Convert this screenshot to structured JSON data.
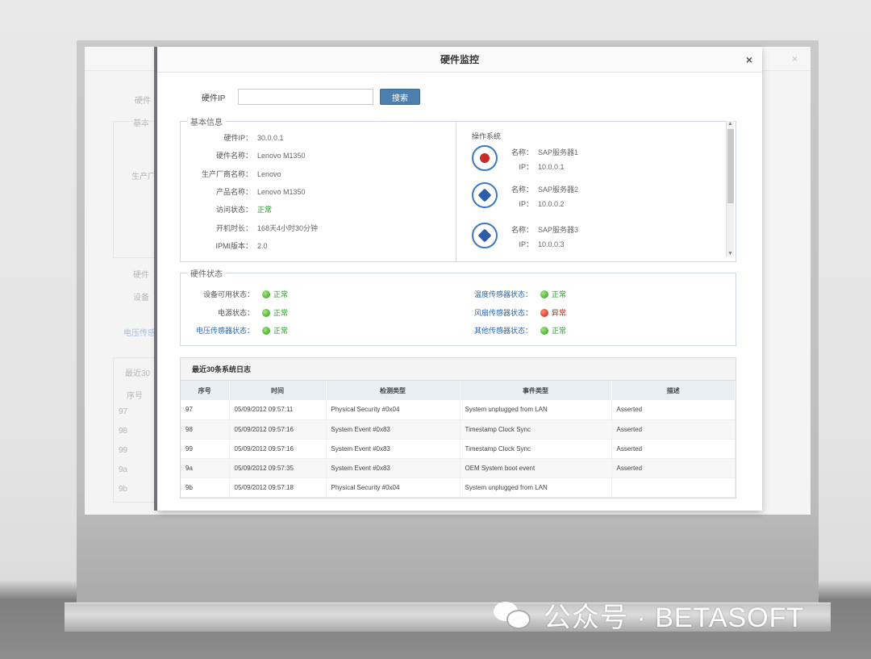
{
  "modal": {
    "title": "硬件监控",
    "close": "×"
  },
  "search": {
    "label": "硬件IP",
    "value": "",
    "button": "搜索"
  },
  "basic_info": {
    "legend": "基本信息",
    "rows": [
      {
        "key": "硬件IP：",
        "value": "30.0.0.1"
      },
      {
        "key": "硬件名称：",
        "value": "Lenovo M1350"
      },
      {
        "key": "生产厂商名称：",
        "value": "Lenovo"
      },
      {
        "key": "产品名称：",
        "value": "Lenovo M1350"
      },
      {
        "key": "访问状态：",
        "value": "正常"
      },
      {
        "key": "开机时长：",
        "value": "168天4小时30分钟"
      },
      {
        "key": "IPMI版本：",
        "value": "2.0"
      }
    ]
  },
  "os": {
    "title": "操作系统",
    "items": [
      {
        "name_key": "名称：",
        "name": "SAP服务器1",
        "ip_key": "IP：",
        "ip": "10.0.0.1",
        "icon": "redhat-icon"
      },
      {
        "name_key": "名称：",
        "name": "SAP服务器2",
        "ip_key": "IP：",
        "ip": "10.0.0.2",
        "icon": "windows-icon"
      },
      {
        "name_key": "名称：",
        "name": "SAP服务器3",
        "ip_key": "IP：",
        "ip": "10.0.0.3",
        "icon": "windows-icon"
      }
    ]
  },
  "hw_status": {
    "legend": "硬件状态",
    "left": [
      {
        "key": "设备可用状态：",
        "value": "正常"
      },
      {
        "key": "电源状态：",
        "value": "正常"
      },
      {
        "key": "电压传感器状态：",
        "value": "正常"
      }
    ],
    "right": [
      {
        "key": "温度传感器状态：",
        "value": "正常"
      },
      {
        "key": "风扇传感器状态：",
        "value": "异常"
      },
      {
        "key": "其他传感器状态：",
        "value": "正常"
      }
    ]
  },
  "log": {
    "title": "最近30条系统日志",
    "columns": [
      "序号",
      "时间",
      "检测类型",
      "事件类型",
      "描述"
    ],
    "rows": [
      [
        "97",
        "05/09/2012  09:57:11",
        "Physical  Security  #0x04",
        "System  unplugged  from  LAN",
        "Asserted"
      ],
      [
        "98",
        "05/09/2012  09:57:16",
        "System  Event  #0x83",
        "Timestamp  Clock  Sync",
        "Asserted"
      ],
      [
        "99",
        "05/09/2012  09:57:16",
        "System  Event  #0x83",
        "Timestamp  Clock  Sync",
        "Asserted"
      ],
      [
        "9a",
        "05/09/2012  09:57:35",
        "System  Event  #0x83",
        "OEM  System  boot  event",
        "Asserted"
      ],
      [
        "9b",
        "05/09/2012  09:57:18",
        "Physical  Security  #0x04",
        "System  unplugged  from  LAN",
        ""
      ]
    ]
  },
  "background": {
    "labels": [
      "硬件",
      "基本",
      "生产厂",
      "硬件",
      "设备",
      "电压传感",
      "最近30",
      "序号",
      "97",
      "98",
      "99",
      "9a",
      "9b"
    ]
  },
  "watermark": {
    "text": "公众号 · BETASOFT"
  },
  "colors": {
    "ok": "#2a9a2a",
    "error": "#c41c0e",
    "link_blue": "#2a66b5",
    "button": "#4d7fae"
  }
}
